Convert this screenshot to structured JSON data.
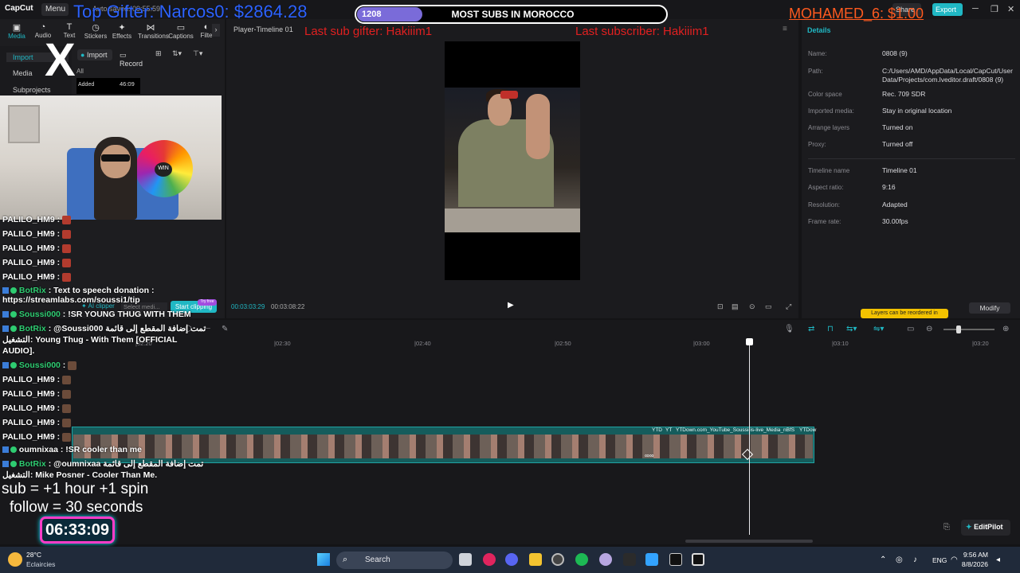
{
  "app": {
    "logo": "CapCut",
    "menu_label": "Menu",
    "autosave": "Auto saved: 09:55:59",
    "share_label": "Share",
    "export_label": "Export"
  },
  "toolbar_tabs": [
    {
      "label": "Media",
      "icon": "media-icon"
    },
    {
      "label": "Audio",
      "icon": "audio-icon"
    },
    {
      "label": "Text",
      "icon": "text-icon"
    },
    {
      "label": "Stickers",
      "icon": "stickers-icon"
    },
    {
      "label": "Effects",
      "icon": "effects-icon"
    },
    {
      "label": "Transitions",
      "icon": "transitions-icon"
    },
    {
      "label": "Captions",
      "icon": "captions-icon"
    },
    {
      "label": "Filte",
      "icon": "filters-icon"
    }
  ],
  "sidebar": {
    "items": [
      {
        "label": "Import"
      },
      {
        "label": "Media"
      },
      {
        "label": "Subprojects"
      }
    ]
  },
  "media_panel": {
    "import_label": "Import",
    "record_label": "Record",
    "all_label": "All",
    "added_label": "Added",
    "duration": "46:09"
  },
  "player": {
    "title": "Player-Timeline 01",
    "current_time": "00:03:03:29",
    "total_time": "00:03:08:22",
    "ai_clipper": "AI clipper",
    "select_media": "Select medi...",
    "start_clipping": "Start clipping",
    "try_badge": "Try free"
  },
  "details": {
    "title": "Details",
    "fields": [
      {
        "key": "Name:",
        "value": "0808 (9)"
      },
      {
        "key": "Path:",
        "value": "C:/Users/AMD/AppData/Local/CapCut/User Data/Projects/com.lveditor.draft/0808 (9)"
      },
      {
        "key": "Color space",
        "value": "Rec. 709 SDR"
      },
      {
        "key": "Imported media:",
        "value": "Stay in original location"
      },
      {
        "key": "Arrange layers",
        "value": "Turned on"
      },
      {
        "key": "Proxy:",
        "value": "Turned off"
      },
      {
        "key": "Timeline name",
        "value": "Timeline 01"
      },
      {
        "key": "Aspect ratio:",
        "value": "9:16"
      },
      {
        "key": "Resolution:",
        "value": "Adapted"
      },
      {
        "key": "Frame rate:",
        "value": "30.00fps"
      }
    ],
    "modify_label": "Modify",
    "layers_hint": "Layers can be reordered in"
  },
  "timeline": {
    "ticks": [
      "|02:20",
      "|02:30",
      "|02:40",
      "|02:50",
      "|03:00",
      "|03:10",
      "|03:20"
    ],
    "clip_labels": [
      "YTD",
      "YT",
      "YTDown.com_YouTube_Soussi-is-live_Media_nBfS",
      "YTDow"
    ],
    "editpilot_label": "EditPilot"
  },
  "overlays": {
    "top_gifter": "Top Gifter: Narcos0: $2864.28",
    "goal_count": "1208",
    "goal_label": "MOST SUBS IN MOROCCO",
    "goal_progress": 0.2,
    "last_sub_gifter": "Last sub gifter: Hakiiim1",
    "last_subscriber": "Last subscriber: Hakiiim1",
    "last_donation": "MOHAMED_6: $1.00",
    "sub_rule": "sub  = +1 hour +1 spin",
    "follow_rule": "follow = 30 seconds",
    "timer": "06:33:09"
  },
  "chat": [
    {
      "user": "PALILO_HM9",
      "text": ":",
      "emote": true
    },
    {
      "user": "PALILO_HM9",
      "text": ":",
      "emote": true
    },
    {
      "user": "PALILO_HM9",
      "text": ":",
      "emote": true
    },
    {
      "user": "PALILO_HM9",
      "text": ":",
      "emote": true
    },
    {
      "user": "PALILO_HM9",
      "text": ":",
      "emote": true
    },
    {
      "user": "BotRix",
      "text": ": Text to speech donation :"
    },
    {
      "user": "",
      "text": "https://streamlabs.com/soussi1/tip"
    },
    {
      "user": "Soussi000",
      "text": ": !SR YOUNG THUG WITH THEM"
    },
    {
      "user": "BotRix",
      "text": ": @Soussi000 تمت إضافة المقطع إلى قائمة"
    },
    {
      "user": "",
      "text": "التشغيل: Young Thug - With Them [OFFICIAL"
    },
    {
      "user": "",
      "text": "AUDIO]."
    },
    {
      "user": "Soussi000",
      "text": ":",
      "emote": true
    },
    {
      "user": "PALILO_HM9",
      "text": ":",
      "emote": true
    },
    {
      "user": "PALILO_HM9",
      "text": ":",
      "emote": true
    },
    {
      "user": "PALILO_HM9",
      "text": ":",
      "emote": true
    },
    {
      "user": "PALILO_HM9",
      "text": ":",
      "emote": true
    },
    {
      "user": "PALILO_HM9",
      "text": ":",
      "emote": true
    },
    {
      "user": "oumnixaa",
      "text": ": !SR cooler than me"
    },
    {
      "user": "BotRix",
      "text": ": @oumnixaa تمت إضافة المقطع إلى قائمة"
    },
    {
      "user": "",
      "text": "التشغيل: Mike Posner - Cooler Than Me."
    }
  ],
  "taskbar": {
    "temp": "28°C",
    "weather": "Eclaircies",
    "search_placeholder": "Search",
    "lang": "ENG",
    "time": "9:56 AM",
    "date": "8/8/2026"
  },
  "colors": {
    "accent": "#20b8c4",
    "gifter": "#2d63ff",
    "red_overlay": "#e02020",
    "donation": "#ff5a1f",
    "timer_border": "#ff3cc8"
  }
}
